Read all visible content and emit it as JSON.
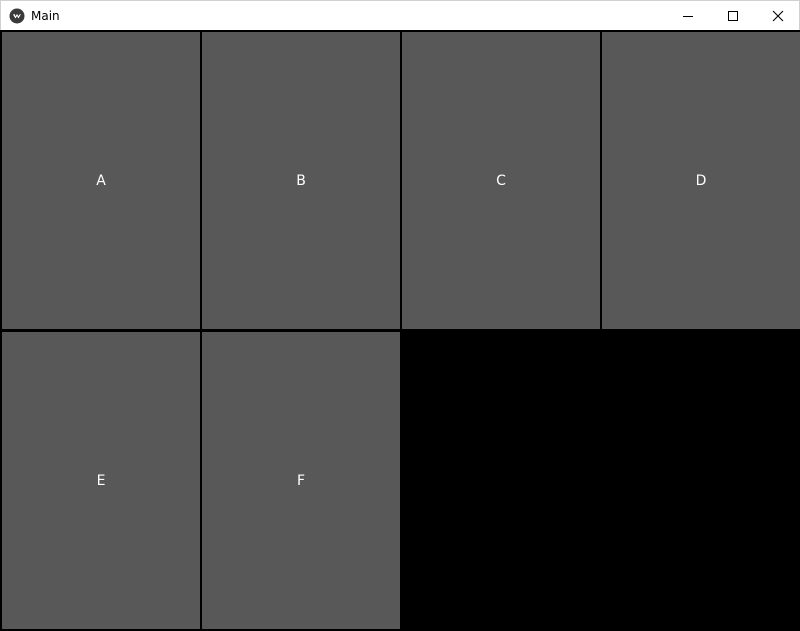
{
  "window": {
    "title": "Main",
    "app_icon": "kivy-logo-icon",
    "controls": {
      "minimize": "minimize-icon",
      "maximize": "maximize-icon",
      "close": "close-icon"
    }
  },
  "grid": {
    "buttons": [
      {
        "label": "A"
      },
      {
        "label": "B"
      },
      {
        "label": "C"
      },
      {
        "label": "D"
      },
      {
        "label": "E"
      },
      {
        "label": "F"
      }
    ],
    "button_color": "#585858",
    "background_color": "#000000",
    "text_color": "#ffffff"
  }
}
